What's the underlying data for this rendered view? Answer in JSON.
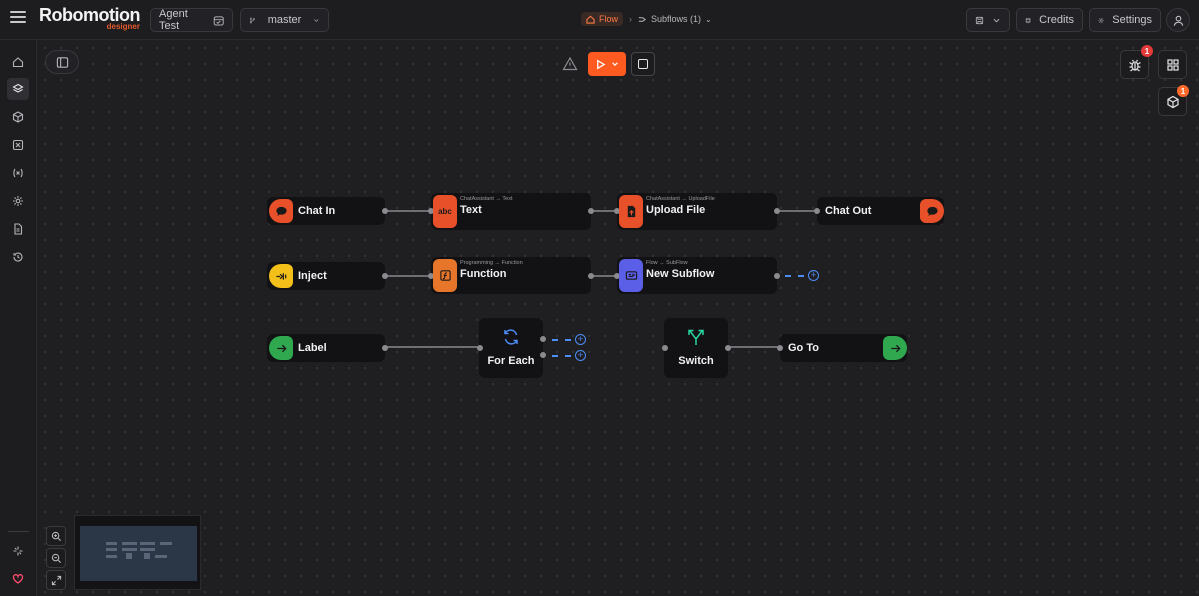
{
  "header": {
    "logo_main": "Robomotion",
    "logo_sub": "designer",
    "project_name": "Agent Test",
    "branch": "master",
    "crumb_flow": "Flow",
    "crumb_subflows": "Subflows (1)",
    "credits_label": "Credits",
    "settings_label": "Settings"
  },
  "sidebar": {
    "items": [
      "home-icon",
      "layers-icon",
      "package-icon",
      "box-x-icon",
      "variable-icon",
      "gear-icon",
      "file-icon",
      "history-icon"
    ],
    "bottom": [
      "sparkle-icon",
      "heart-icon"
    ]
  },
  "toolbar": {
    "debug_badge": "1",
    "packages_badge": "1"
  },
  "nodes": {
    "chat_in": {
      "title": "Chat In"
    },
    "text": {
      "title": "Text",
      "sub": "ChatAssistant → Text"
    },
    "upload_file": {
      "title": "Upload File",
      "sub": "ChatAssistant → UploadFile"
    },
    "chat_out": {
      "title": "Chat Out"
    },
    "inject": {
      "title": "Inject"
    },
    "function": {
      "title": "Function",
      "sub": "Programming → Function"
    },
    "new_subflow": {
      "title": "New Subflow",
      "sub": "Flow → SubFlow"
    },
    "label": {
      "title": "Label"
    },
    "for_each": {
      "title": "For Each"
    },
    "switch": {
      "title": "Switch"
    },
    "go_to": {
      "title": "Go To"
    }
  },
  "colors": {
    "accent": "#ff5a1f",
    "chat_icon": "#e8502a",
    "inject_icon": "#f2c019",
    "function_icon": "#e8762a",
    "subflow_icon": "#5b5ee6",
    "label_icon": "#2fa84f",
    "switch_icon": "#28d4a0",
    "port_blue": "#4d8df5"
  }
}
